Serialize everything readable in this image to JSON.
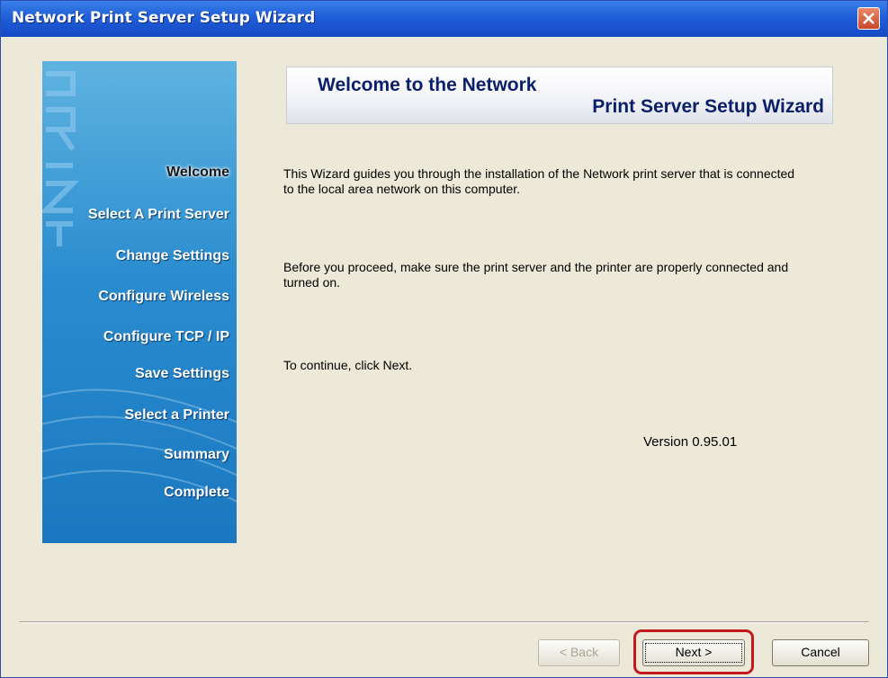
{
  "window": {
    "title": "Network Print Server Setup Wizard"
  },
  "sidebar": {
    "watermark_text": "PRINT",
    "steps": [
      {
        "label": "Welcome",
        "active": true
      },
      {
        "label": "Select A Print Server",
        "active": false
      },
      {
        "label": "Change Settings",
        "active": false
      },
      {
        "label": "Configure Wireless",
        "active": false
      },
      {
        "label": "Configure TCP / IP",
        "active": false
      },
      {
        "label": "Save Settings",
        "active": false
      },
      {
        "label": "Select a Printer",
        "active": false
      },
      {
        "label": "Summary",
        "active": false
      },
      {
        "label": "Complete",
        "active": false
      }
    ]
  },
  "header": {
    "line1": "Welcome to the Network",
    "line2": "Print Server Setup Wizard"
  },
  "body": {
    "intro": "This Wizard guides you through the installation of the Network print server that is connected to the local area network on this computer.",
    "before": "Before you proceed, make sure the print server and the printer are properly connected and turned on.",
    "continue": "To continue, click Next.",
    "version": "Version 0.95.01"
  },
  "buttons": {
    "back": "< Back",
    "next": "Next >",
    "cancel": "Cancel"
  },
  "colors": {
    "titlebar": "#1f5fd8",
    "sidebar": "#2a8ccf",
    "highlight": "#c2181e"
  }
}
